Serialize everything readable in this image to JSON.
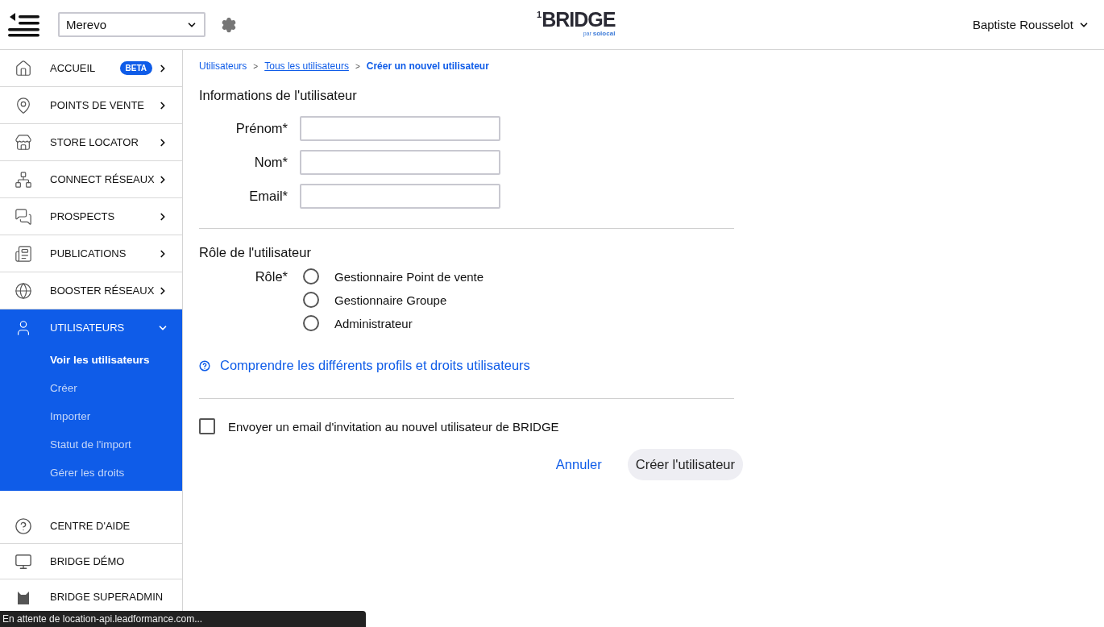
{
  "header": {
    "account_select": {
      "value": "Merevo"
    },
    "logo": {
      "mark": "1",
      "name": "BRIDGE",
      "by": "par",
      "brand": "solocal"
    },
    "user": {
      "name": "Baptiste Rousselot"
    }
  },
  "sidebar": {
    "items": [
      {
        "label": "ACCUEIL",
        "badge": "BETA",
        "selected": false,
        "expanded": false
      },
      {
        "label": "POINTS DE VENTE",
        "selected": false,
        "expanded": false
      },
      {
        "label": "STORE LOCATOR",
        "selected": false,
        "expanded": false
      },
      {
        "label": "CONNECT RÉSEAUX",
        "selected": false,
        "expanded": false
      },
      {
        "label": "PROSPECTS",
        "selected": false,
        "expanded": false
      },
      {
        "label": "PUBLICATIONS",
        "selected": false,
        "expanded": false
      },
      {
        "label": "BOOSTER RÉSEAUX",
        "selected": false,
        "expanded": false
      },
      {
        "label": "UTILISATEURS",
        "selected": true,
        "expanded": true,
        "children": [
          {
            "label": "Voir les utilisateurs",
            "selected": true
          },
          {
            "label": "Créer",
            "selected": false
          },
          {
            "label": "Importer",
            "selected": false
          },
          {
            "label": "Statut de l'import",
            "selected": false
          },
          {
            "label": "Gérer les droits",
            "selected": false
          }
        ]
      }
    ],
    "footer_items": [
      {
        "label": "CENTRE D'AIDE"
      },
      {
        "label": "BRIDGE DÉMO"
      },
      {
        "label": "BRIDGE SUPERADMIN"
      }
    ]
  },
  "breadcrumb": [
    {
      "label": "Utilisateurs",
      "kind": "plain"
    },
    {
      "label": "Tous les utilisateurs",
      "kind": "link"
    },
    {
      "label": "Créer un nouvel utilisateur",
      "kind": "current"
    }
  ],
  "breadcrumb_separator": ">",
  "info_section": {
    "title": "Informations de l'utilisateur",
    "fields": [
      {
        "label": "Prénom*"
      },
      {
        "label": "Nom*"
      },
      {
        "label": "Email*"
      }
    ]
  },
  "role_section": {
    "title": "Rôle de l'utilisateur",
    "label": "Rôle*",
    "options": [
      {
        "label": "Gestionnaire Point de vente",
        "selected": false
      },
      {
        "label": "Gestionnaire Groupe",
        "selected": false
      },
      {
        "label": "Administrateur",
        "selected": false
      }
    ]
  },
  "help_link": "Comprendre les différents profils et droits utilisateurs",
  "invite": {
    "label": "Envoyer un email d'invitation au nouvel utilisateur de BRIDGE",
    "checked": false
  },
  "buttons": {
    "cancel": "Annuler",
    "submit": "Créer l'utilisateur"
  },
  "status_bar": "En attente de location-api.leadformance.com..."
}
